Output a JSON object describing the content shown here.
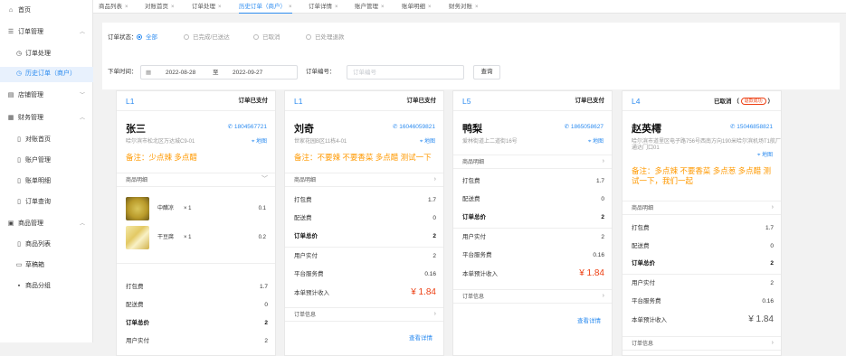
{
  "sidebar": {
    "home": "首页",
    "order_mgmt": "订单管理",
    "order_process": "订单处理",
    "history_order": "历史订单（商户）",
    "store_mgmt": "店铺管理",
    "finance_mgmt": "财务管理",
    "recon_home": "对账首页",
    "account_mgmt": "账户管理",
    "bill_detail": "账单明细",
    "order_query": "订单查询",
    "goods_mgmt": "商品管理",
    "goods_list": "商品列表",
    "draft_box": "草稿箱",
    "goods_group": "商品分组"
  },
  "tabs": [
    {
      "label": "商品列表"
    },
    {
      "label": "对账首页"
    },
    {
      "label": "订单处理"
    },
    {
      "label": "历史订单（商户）"
    },
    {
      "label": "订单详情"
    },
    {
      "label": "账户管理"
    },
    {
      "label": "账单明细"
    },
    {
      "label": "财务对账"
    }
  ],
  "filter": {
    "status_label": "订单状态：",
    "status_options": [
      "全部",
      "已完成/已送达",
      "已取消",
      "已处理退款"
    ],
    "time_label": "下单时间：",
    "date_start": "2022-08-28",
    "date_sep": "至",
    "date_end": "2022-09-27",
    "order_no_label": "订单编号：",
    "order_no_placeholder": "订单编号",
    "search_button": "查询"
  },
  "cards": [
    {
      "num": "L1",
      "status": "订单已支付",
      "name": "张三",
      "phone": "18045677​21",
      "address": "哈尔滨市松北区万达城C9-01",
      "map": "地图",
      "note": "备注：少点辣 多点醋",
      "goods_label": "商品明细",
      "goods": [
        {
          "name": "中醋凉",
          "qty": "× 1",
          "price": "0.1"
        },
        {
          "name": "干豆腐",
          "qty": "× 1",
          "price": "0.2"
        }
      ],
      "rows": [
        {
          "k": "打包费",
          "v": "1.7"
        },
        {
          "k": "配送费",
          "v": "0"
        },
        {
          "k": "订单总价",
          "v": "2"
        },
        {
          "k": "用户实付",
          "v": "2"
        }
      ]
    },
    {
      "num": "L1",
      "status": "订单已支付",
      "name": "刘奇",
      "phone": "16046059821",
      "address": "世家花园B区11栋4-01",
      "map": "地图",
      "note": "备注：不要辣 不要香菜 多点醋 测试一下",
      "goods_label": "商品明细",
      "rows": [
        {
          "k": "打包费",
          "v": "1.7"
        },
        {
          "k": "配送费",
          "v": "0"
        },
        {
          "k": "订单总价",
          "v": "2"
        },
        {
          "k": "用户实付",
          "v": "2"
        },
        {
          "k": "平台服务费",
          "v": "0.16"
        },
        {
          "k": "本单预计收入",
          "v": "¥ 1.84"
        }
      ],
      "order_info": "订单信息",
      "view_detail": "查看详情"
    },
    {
      "num": "L5",
      "status": "订单已支付",
      "name": "鸭梨",
      "phone": "18650586​27",
      "address": "爱林街道上二道街16号",
      "map": "地图",
      "goods_label": "商品明细",
      "rows": [
        {
          "k": "打包费",
          "v": "1.7"
        },
        {
          "k": "配送费",
          "v": "0"
        },
        {
          "k": "订单总价",
          "v": "2"
        },
        {
          "k": "用户实付",
          "v": "2"
        },
        {
          "k": "平台服务费",
          "v": "0.16"
        },
        {
          "k": "本单预计收入",
          "v": "¥ 1.84"
        }
      ],
      "order_info": "订单信息",
      "view_detail": "查看详情"
    },
    {
      "num": "L4",
      "status": "已取消",
      "refund_badge": "退款成功",
      "name": "赵英樗",
      "phone": "15046858821",
      "address": "哈尔滨市道里区电子路756号西南方向190米哈尔滨机场T1航厂通达门口01",
      "map": "地图",
      "note": "备注：多点辣 不要香菜 多点葱 多点醋 测试一下，我们一起",
      "goods_label": "商品明细",
      "rows": [
        {
          "k": "打包费",
          "v": "1.7"
        },
        {
          "k": "配送费",
          "v": "0"
        },
        {
          "k": "订单总价",
          "v": "2"
        },
        {
          "k": "用户实付",
          "v": "2"
        },
        {
          "k": "平台服务费",
          "v": "0.16"
        },
        {
          "k": "本单预计收入",
          "v": "¥ 1.84"
        }
      ],
      "order_info": "订单信息"
    }
  ]
}
